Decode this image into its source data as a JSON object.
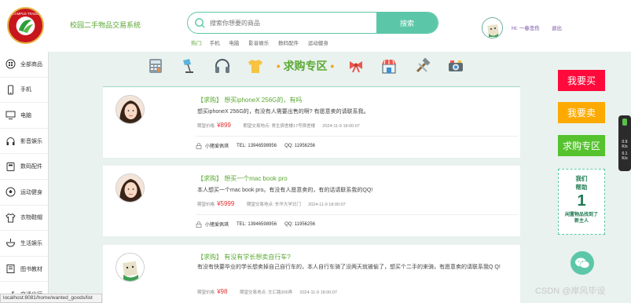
{
  "header": {
    "logo_text": "CAMPUS TRADE",
    "site_title": "校园二手物品交易系统",
    "search_placeholder": "搜索你想要的商品",
    "search_button": "搜索",
    "hot_label": "热门:",
    "hot_tags": [
      "手机",
      "电脑",
      "影音娱乐",
      "数码配件",
      "运动健身"
    ],
    "user_greeting": "Hi: 一春悲伤",
    "logout": "退出"
  },
  "sidebar": {
    "items": [
      {
        "label": "全部商品",
        "icon": "grid-icon"
      },
      {
        "label": "手机",
        "icon": "phone-icon"
      },
      {
        "label": "电脑",
        "icon": "monitor-icon"
      },
      {
        "label": "影音娱乐",
        "icon": "headphones-icon"
      },
      {
        "label": "数码配件",
        "icon": "storage-icon"
      },
      {
        "label": "运动健身",
        "icon": "ball-icon"
      },
      {
        "label": "衣物鞋帽",
        "icon": "shirt-icon"
      },
      {
        "label": "生活娱乐",
        "icon": "bowl-icon"
      },
      {
        "label": "图书教材",
        "icon": "book-icon"
      },
      {
        "label": "交通出行",
        "icon": "scooter-icon"
      }
    ]
  },
  "category_bar": {
    "heading": "求购专区",
    "icons": [
      "calculator-icon",
      "lamp-icon",
      "headphones-icon",
      "tshirt-icon",
      "bow-icon",
      "shop-icon",
      "tools-icon",
      "camera-icon"
    ]
  },
  "meta_labels": {
    "price": "期望价格",
    "location": "期望交易地点:",
    "tel": "TEL:",
    "qq": "QQ:"
  },
  "posts": [
    {
      "title": "【求购】 想买iphoneX 256G的，有吗",
      "description": "想买iphoneX 256G的，有没有人需要出售的啊? 有愿意卖的请联系我。",
      "price": "¥899",
      "location": "男生宿舍楼17号宿舍楼",
      "date": "2024-11-9 18:00:07",
      "user": "小猪爱佩琪",
      "tel": "13946598956",
      "qq": "11956256"
    },
    {
      "title": "【求购】 想买一个mac book pro",
      "description": "本人想买一个mac book pro。有没有人愿意卖的，有的话请联系我的QQ!",
      "price": "¥5999",
      "location": "东华大学北门",
      "date": "2024-11-9 18:00:07",
      "user": "小猪爱佩琪",
      "tel": "13946598956",
      "qq": "11956256"
    },
    {
      "title": "【求购】 有没有学长想卖自行车?",
      "description": "有没有快要毕业的学长想卖掉自己自行车的，本人自行车骑了没两天就被偷了，想买个二手的来骑，有愿意卖的请联系我Q Q!",
      "price": "¥98",
      "location": "文汇路300弄",
      "date": "2024-11-9 18:00:07"
    }
  ],
  "right_buttons": {
    "want_buy": "我要买",
    "want_sell": "我要卖",
    "wanted_zone": "求购专区"
  },
  "help_box": {
    "line1": "我们",
    "line2": "帮助",
    "count": "1",
    "line3": "闲置物品找到了",
    "line4": "新主人"
  },
  "speed_widget": {
    "v1": "0.9",
    "u1": "K/s",
    "v2": "0.1",
    "u2": "K/s"
  },
  "status_url": "localhost:8081/home/wanted_goods/list",
  "watermark": "CSDN @岸风毕设",
  "colors": {
    "accent": "#5cc7a8",
    "green_text": "#5aa832",
    "price_red": "#e53030",
    "btn_buy": "#ff0a3b",
    "btn_sell": "#fdaa00",
    "btn_wanted": "#55c22e"
  }
}
